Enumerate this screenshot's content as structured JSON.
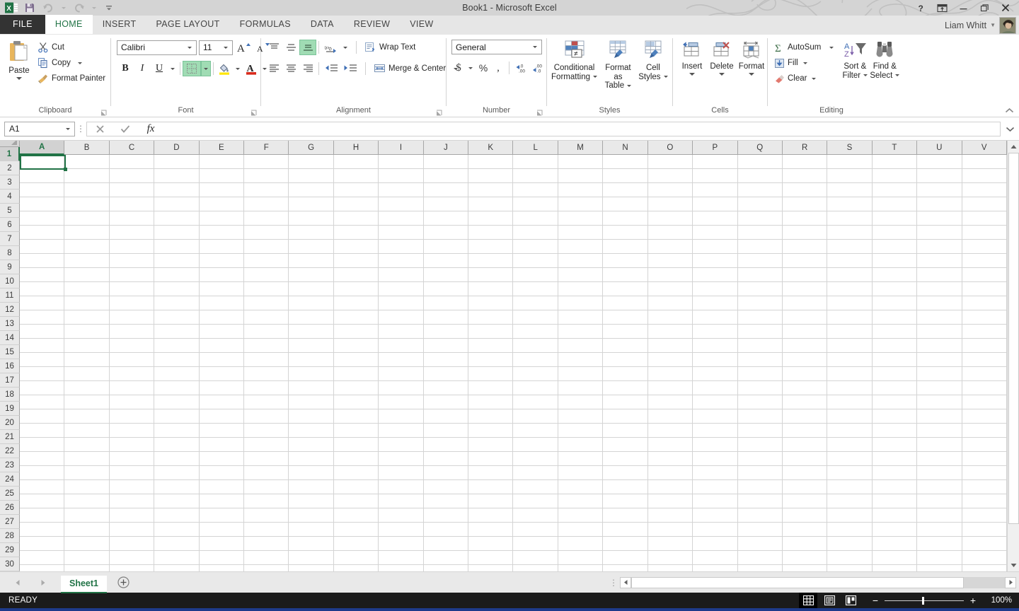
{
  "titlebar": {
    "document_title": "Book1 - Microsoft Excel",
    "quick_access": [
      {
        "name": "excel-logo",
        "label": "Excel"
      },
      {
        "name": "save-icon",
        "label": "Save"
      },
      {
        "name": "undo-icon",
        "label": "Undo"
      },
      {
        "name": "redo-icon",
        "label": "Redo"
      },
      {
        "name": "customize-qat-icon",
        "label": "Customize Quick Access Toolbar"
      }
    ],
    "window_controls": [
      {
        "name": "help-button",
        "label": "?"
      },
      {
        "name": "ribbon-display-options-button",
        "label": "Ribbon Display Options"
      },
      {
        "name": "minimize-button",
        "label": "Minimize"
      },
      {
        "name": "restore-button",
        "label": "Restore Down"
      },
      {
        "name": "close-button",
        "label": "Close"
      }
    ]
  },
  "tabs": {
    "file_label": "FILE",
    "items": [
      {
        "label": "HOME",
        "active": true
      },
      {
        "label": "INSERT",
        "active": false
      },
      {
        "label": "PAGE LAYOUT",
        "active": false
      },
      {
        "label": "FORMULAS",
        "active": false
      },
      {
        "label": "DATA",
        "active": false
      },
      {
        "label": "REVIEW",
        "active": false
      },
      {
        "label": "VIEW",
        "active": false
      }
    ],
    "user_name": "Liam Whitt"
  },
  "ribbon": {
    "clipboard": {
      "group_label": "Clipboard",
      "paste_label": "Paste",
      "cut_label": "Cut",
      "copy_label": "Copy",
      "format_painter_label": "Format Painter"
    },
    "font": {
      "group_label": "Font",
      "font_name": "Calibri",
      "font_size": "11",
      "bold_label": "B",
      "italic_label": "I",
      "underline_label": "U",
      "grow_font_label": "A",
      "shrink_font_label": "A"
    },
    "alignment": {
      "group_label": "Alignment",
      "wrap_text_label": "Wrap Text",
      "merge_center_label": "Merge & Center"
    },
    "number": {
      "group_label": "Number",
      "format_value": "General",
      "currency_label": "$",
      "percent_label": "%",
      "comma_label": ","
    },
    "styles": {
      "group_label": "Styles",
      "conditional_formatting_label": "Conditional\nFormatting",
      "conditional_formatting_line1": "Conditional",
      "conditional_formatting_line2": "Formatting",
      "format_as_table_line1": "Format as",
      "format_as_table_line2": "Table",
      "cell_styles_line1": "Cell",
      "cell_styles_line2": "Styles"
    },
    "cells": {
      "group_label": "Cells",
      "insert_label": "Insert",
      "delete_label": "Delete",
      "format_label": "Format"
    },
    "editing": {
      "group_label": "Editing",
      "autosum_label": "AutoSum",
      "fill_label": "Fill",
      "clear_label": "Clear",
      "sort_filter_line1": "Sort &",
      "sort_filter_line2": "Filter",
      "find_select_line1": "Find &",
      "find_select_line2": "Select"
    }
  },
  "formula_bar": {
    "name_box_value": "A1",
    "cancel_label": "Cancel",
    "enter_label": "Enter",
    "insert_function_label": "fx",
    "formula_value": "",
    "expand_label": "Expand Formula Bar"
  },
  "grid": {
    "columns": [
      "A",
      "B",
      "C",
      "D",
      "E",
      "F",
      "G",
      "H",
      "I",
      "J",
      "K",
      "L",
      "M",
      "N",
      "O",
      "P",
      "Q",
      "R",
      "S",
      "T",
      "U",
      "V"
    ],
    "rows": [
      "1",
      "2",
      "3",
      "4",
      "5",
      "6",
      "7",
      "8",
      "9",
      "10",
      "11",
      "12",
      "13",
      "14",
      "15",
      "16",
      "17",
      "18",
      "19",
      "20",
      "21",
      "22",
      "23",
      "24",
      "25",
      "26",
      "27",
      "28",
      "29",
      "30"
    ],
    "selected_cell": "A1",
    "selected_column": "A",
    "selected_row": "1",
    "cell_values": {}
  },
  "sheet_bar": {
    "sheets": [
      {
        "label": "Sheet1",
        "active": true
      }
    ],
    "add_sheet_label": "+",
    "prev_label": "Previous Sheet",
    "next_label": "Next Sheet"
  },
  "status_bar": {
    "status_text": "READY",
    "views": [
      {
        "name": "normal-view-button",
        "active": true
      },
      {
        "name": "page-layout-view-button",
        "active": false
      },
      {
        "name": "page-break-preview-button",
        "active": false
      }
    ],
    "zoom_out_label": "−",
    "zoom_in_label": "+",
    "zoom_level": "100%"
  },
  "colors": {
    "excel_green": "#217346",
    "titlebar_bg": "#d4d4d4",
    "ribbon_bg": "#ffffff",
    "header_bg": "#e9e9e9",
    "status_bg": "#1b1b1b",
    "accent_blue": "#1e3a8a"
  }
}
